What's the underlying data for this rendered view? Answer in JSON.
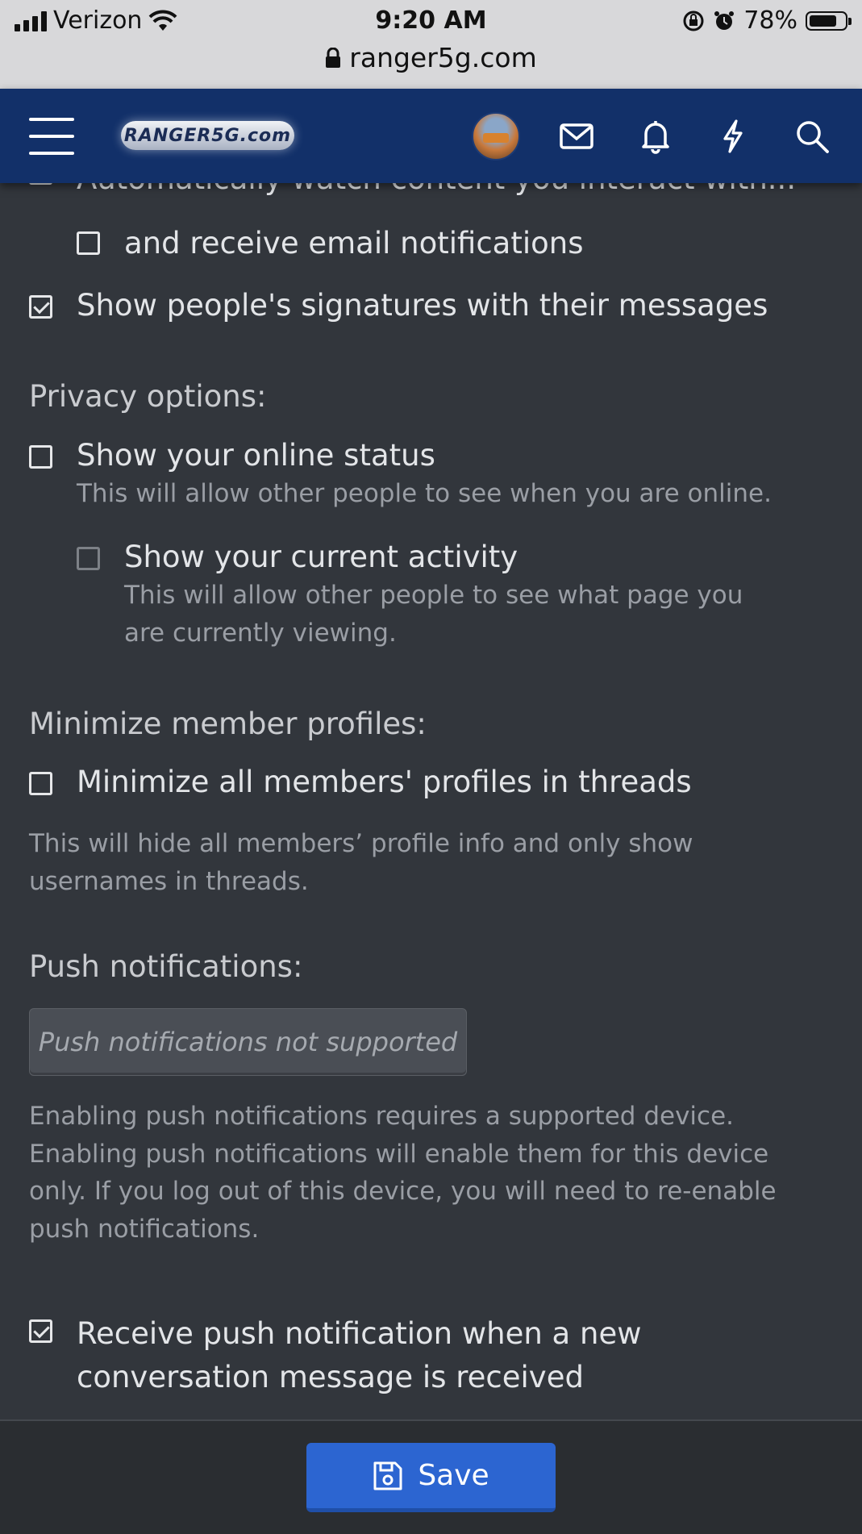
{
  "statusbar": {
    "carrier": "Verizon",
    "time": "9:20 AM",
    "battery": "78%",
    "battery_level": 0.78,
    "url": "ranger5g.com"
  },
  "header": {
    "logo_text": "RANGER5G.com",
    "icons": [
      "menu-icon",
      "avatar",
      "mail-icon",
      "bell-icon",
      "bolt-icon",
      "search-icon"
    ],
    "background": "#123069"
  },
  "preferences": {
    "auto_watch_label": "Automatically watch content you interact with...",
    "email_notify_label": "and receive email notifications",
    "signatures_label": "Show people's signatures with their messages",
    "privacy_heading": "Privacy options:",
    "online_status_label": "Show your online status",
    "online_status_hint": "This will allow other people to see when you are online.",
    "activity_label": "Show your current activity",
    "activity_hint_1": "This will allow other people to see what page you",
    "activity_hint_2": "are currently viewing.",
    "minimize_heading": "Minimize member profiles:",
    "minimize_label": "Minimize all members' profiles in threads",
    "minimize_hint_1": "This will hide all members’ profile info and only show",
    "minimize_hint_2": "usernames in threads.",
    "push_heading": "Push notifications:",
    "push_button": "Push notifications not supported",
    "push_hint_1": "Enabling push notifications requires a supported device.",
    "push_hint_2": "Enabling push notifications will enable them for this device",
    "push_hint_3": "only. If you log out of this device, you will need to re-enable",
    "push_hint_4": "push notifications.",
    "push_conv_label_1": "Receive push notification when a new",
    "push_conv_label_2": "conversation message is received"
  },
  "states": {
    "auto_watch": true,
    "email_notify": false,
    "signatures": true,
    "online_status": false,
    "activity": false,
    "minimize": false,
    "push_conv": true
  },
  "footer": {
    "save_label": "Save",
    "save_color": "#2c65d1"
  }
}
